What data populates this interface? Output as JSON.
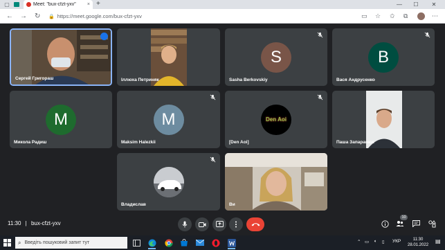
{
  "browser": {
    "tab_title": "Meet: \"bux-cfzt-yxv\"",
    "tab_close": "×",
    "new_tab": "+",
    "url": "https://meet.google.com/bux-cfzt-yxv",
    "window_min": "—",
    "window_max": "☐",
    "window_close": "✕"
  },
  "tiles": [
    {
      "name": "Сергей Григораш",
      "type": "video",
      "speaking": true
    },
    {
      "name": "Іллюха Петриняк",
      "type": "video",
      "muted": false
    },
    {
      "name": "Sasha Berkovskiy",
      "type": "avatar",
      "initial": "S",
      "color": "#795548",
      "muted": true
    },
    {
      "name": "Вася Андрусенко",
      "type": "avatar",
      "initial": "B",
      "color": "#004d40",
      "muted": true
    },
    {
      "name": "Микола Радиш",
      "type": "avatar",
      "initial": "M",
      "color": "#1e6b2e",
      "muted": false
    },
    {
      "name": "Maksim Halezkii",
      "type": "avatar",
      "initial": "M",
      "color": "#6d8ca0",
      "muted": true
    },
    {
      "name": "[Den Aoi]",
      "type": "avatar-image",
      "image_text": "Den Aoi",
      "muted": true
    },
    {
      "name": "Паша Запаранюк",
      "type": "video",
      "muted": false
    },
    {
      "name": "Владислав",
      "type": "avatar-image",
      "muted": true
    },
    {
      "name": "Ви",
      "type": "video",
      "muted": false
    }
  ],
  "bottombar": {
    "time": "11:30",
    "separator": "|",
    "meeting_code": "bux-cfzt-yxv",
    "participants_count": "10"
  },
  "taskbar": {
    "search_placeholder": "Введіть пошуковий запит тут",
    "language": "УКР",
    "time": "11:30",
    "date": "28.01.2022"
  },
  "colors": {
    "meet_bg": "#202124",
    "tile_bg": "#3c4043",
    "end_call": "#ea4335",
    "speaking_border": "#8ab4f8"
  }
}
